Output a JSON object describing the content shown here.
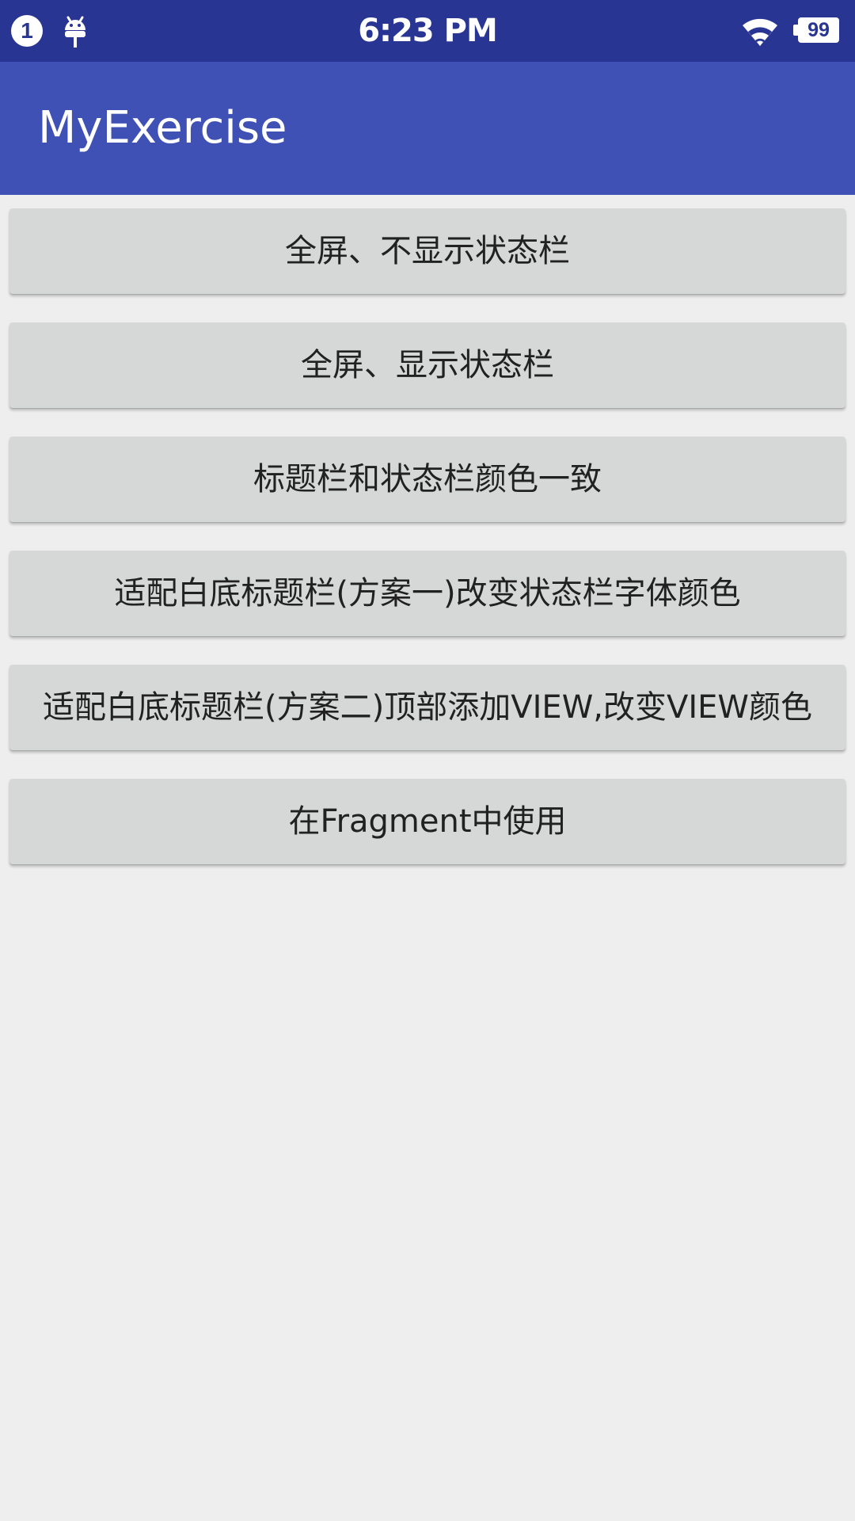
{
  "status_bar": {
    "notification_count": "1",
    "time": "6:23 PM",
    "battery_level": "99",
    "icons": [
      "notification-count-icon",
      "android-debug-icon",
      "wifi-icon",
      "battery-icon"
    ]
  },
  "app_bar": {
    "title": "MyExercise"
  },
  "buttons": [
    {
      "label": "全屏、不显示状态栏"
    },
    {
      "label": "全屏、显示状态栏"
    },
    {
      "label": "标题栏和状态栏颜色一致"
    },
    {
      "label": "适配白底标题栏(方案一)改变状态栏字体颜色"
    },
    {
      "label": "适配白底标题栏(方案二)顶部添加VIEW,改变VIEW颜色"
    },
    {
      "label": "在Fragment中使用"
    }
  ],
  "colors": {
    "status_bar": "#283593",
    "app_bar": "#3f51b5",
    "background": "#eeeeee",
    "button": "#d6d7d7",
    "button_text": "#212121"
  }
}
